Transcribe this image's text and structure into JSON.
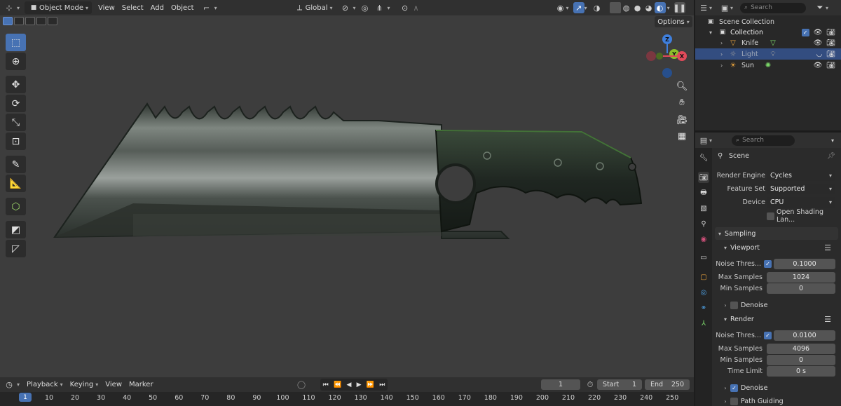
{
  "viewport_header": {
    "mode": "Object Mode",
    "menus": [
      "View",
      "Select",
      "Add",
      "Object"
    ],
    "orientation": "Global",
    "options": "Options"
  },
  "toolbar": [
    "select-box-tool",
    "cursor-tool",
    "move-tool",
    "rotate-tool",
    "scale-tool",
    "transform-tool",
    "annotate-tool",
    "measure-tool",
    "add-cube-tool",
    "shear-tool",
    "edge-tool"
  ],
  "gizmo": {
    "z": "Z",
    "y": "Y",
    "x": "X"
  },
  "outliner": {
    "search_placeholder": "Search",
    "root": "Scene Collection",
    "collection": "Collection",
    "items": [
      {
        "name": "Knife",
        "icon": "mesh-icon",
        "color": "#e8a23c",
        "selected": false
      },
      {
        "name": "Light",
        "icon": "light-icon",
        "color": "#9a9a9a",
        "selected": true
      },
      {
        "name": "Sun",
        "icon": "sun-icon",
        "color": "#e8a23c",
        "selected": false
      }
    ]
  },
  "properties": {
    "search_placeholder": "Search",
    "context": "Scene",
    "render_engine": {
      "label": "Render Engine",
      "value": "Cycles"
    },
    "feature_set": {
      "label": "Feature Set",
      "value": "Supported"
    },
    "device": {
      "label": "Device",
      "value": "CPU"
    },
    "open_shading": {
      "label": "Open Shading Lan...",
      "checked": false
    },
    "sampling": {
      "title": "Sampling",
      "viewport": {
        "title": "Viewport",
        "noise_label": "Noise Thres...",
        "noise_checked": true,
        "noise_value": "0.1000",
        "max_label": "Max Samples",
        "max_value": "1024",
        "min_label": "Min Samples",
        "min_value": "0",
        "denoise": {
          "label": "Denoise",
          "checked": false
        }
      },
      "render": {
        "title": "Render",
        "noise_label": "Noise Thres...",
        "noise_checked": true,
        "noise_value": "0.0100",
        "max_label": "Max Samples",
        "max_value": "4096",
        "min_label": "Min Samples",
        "min_value": "0",
        "time_label": "Time Limit",
        "time_value": "0 s",
        "denoise": {
          "label": "Denoise",
          "checked": true
        }
      },
      "path_guiding": {
        "label": "Path Guiding",
        "checked": false
      }
    }
  },
  "timeline": {
    "menus": [
      "Playback",
      "Keying",
      "View",
      "Marker"
    ],
    "current_frame": "1",
    "start_label": "Start",
    "start_value": "1",
    "end_label": "End",
    "end_value": "250",
    "ruler_current": "1",
    "ticks": [
      "10",
      "20",
      "30",
      "40",
      "50",
      "60",
      "70",
      "80",
      "90",
      "100",
      "110",
      "120",
      "130",
      "140",
      "150",
      "160",
      "170",
      "180",
      "190",
      "200",
      "210",
      "220",
      "230",
      "240",
      "250"
    ]
  },
  "colors": {
    "accent": "#4772b3",
    "x_axis": "#e04a5a",
    "y_axis": "#8bbf2a",
    "z_axis": "#3f7fdc"
  }
}
